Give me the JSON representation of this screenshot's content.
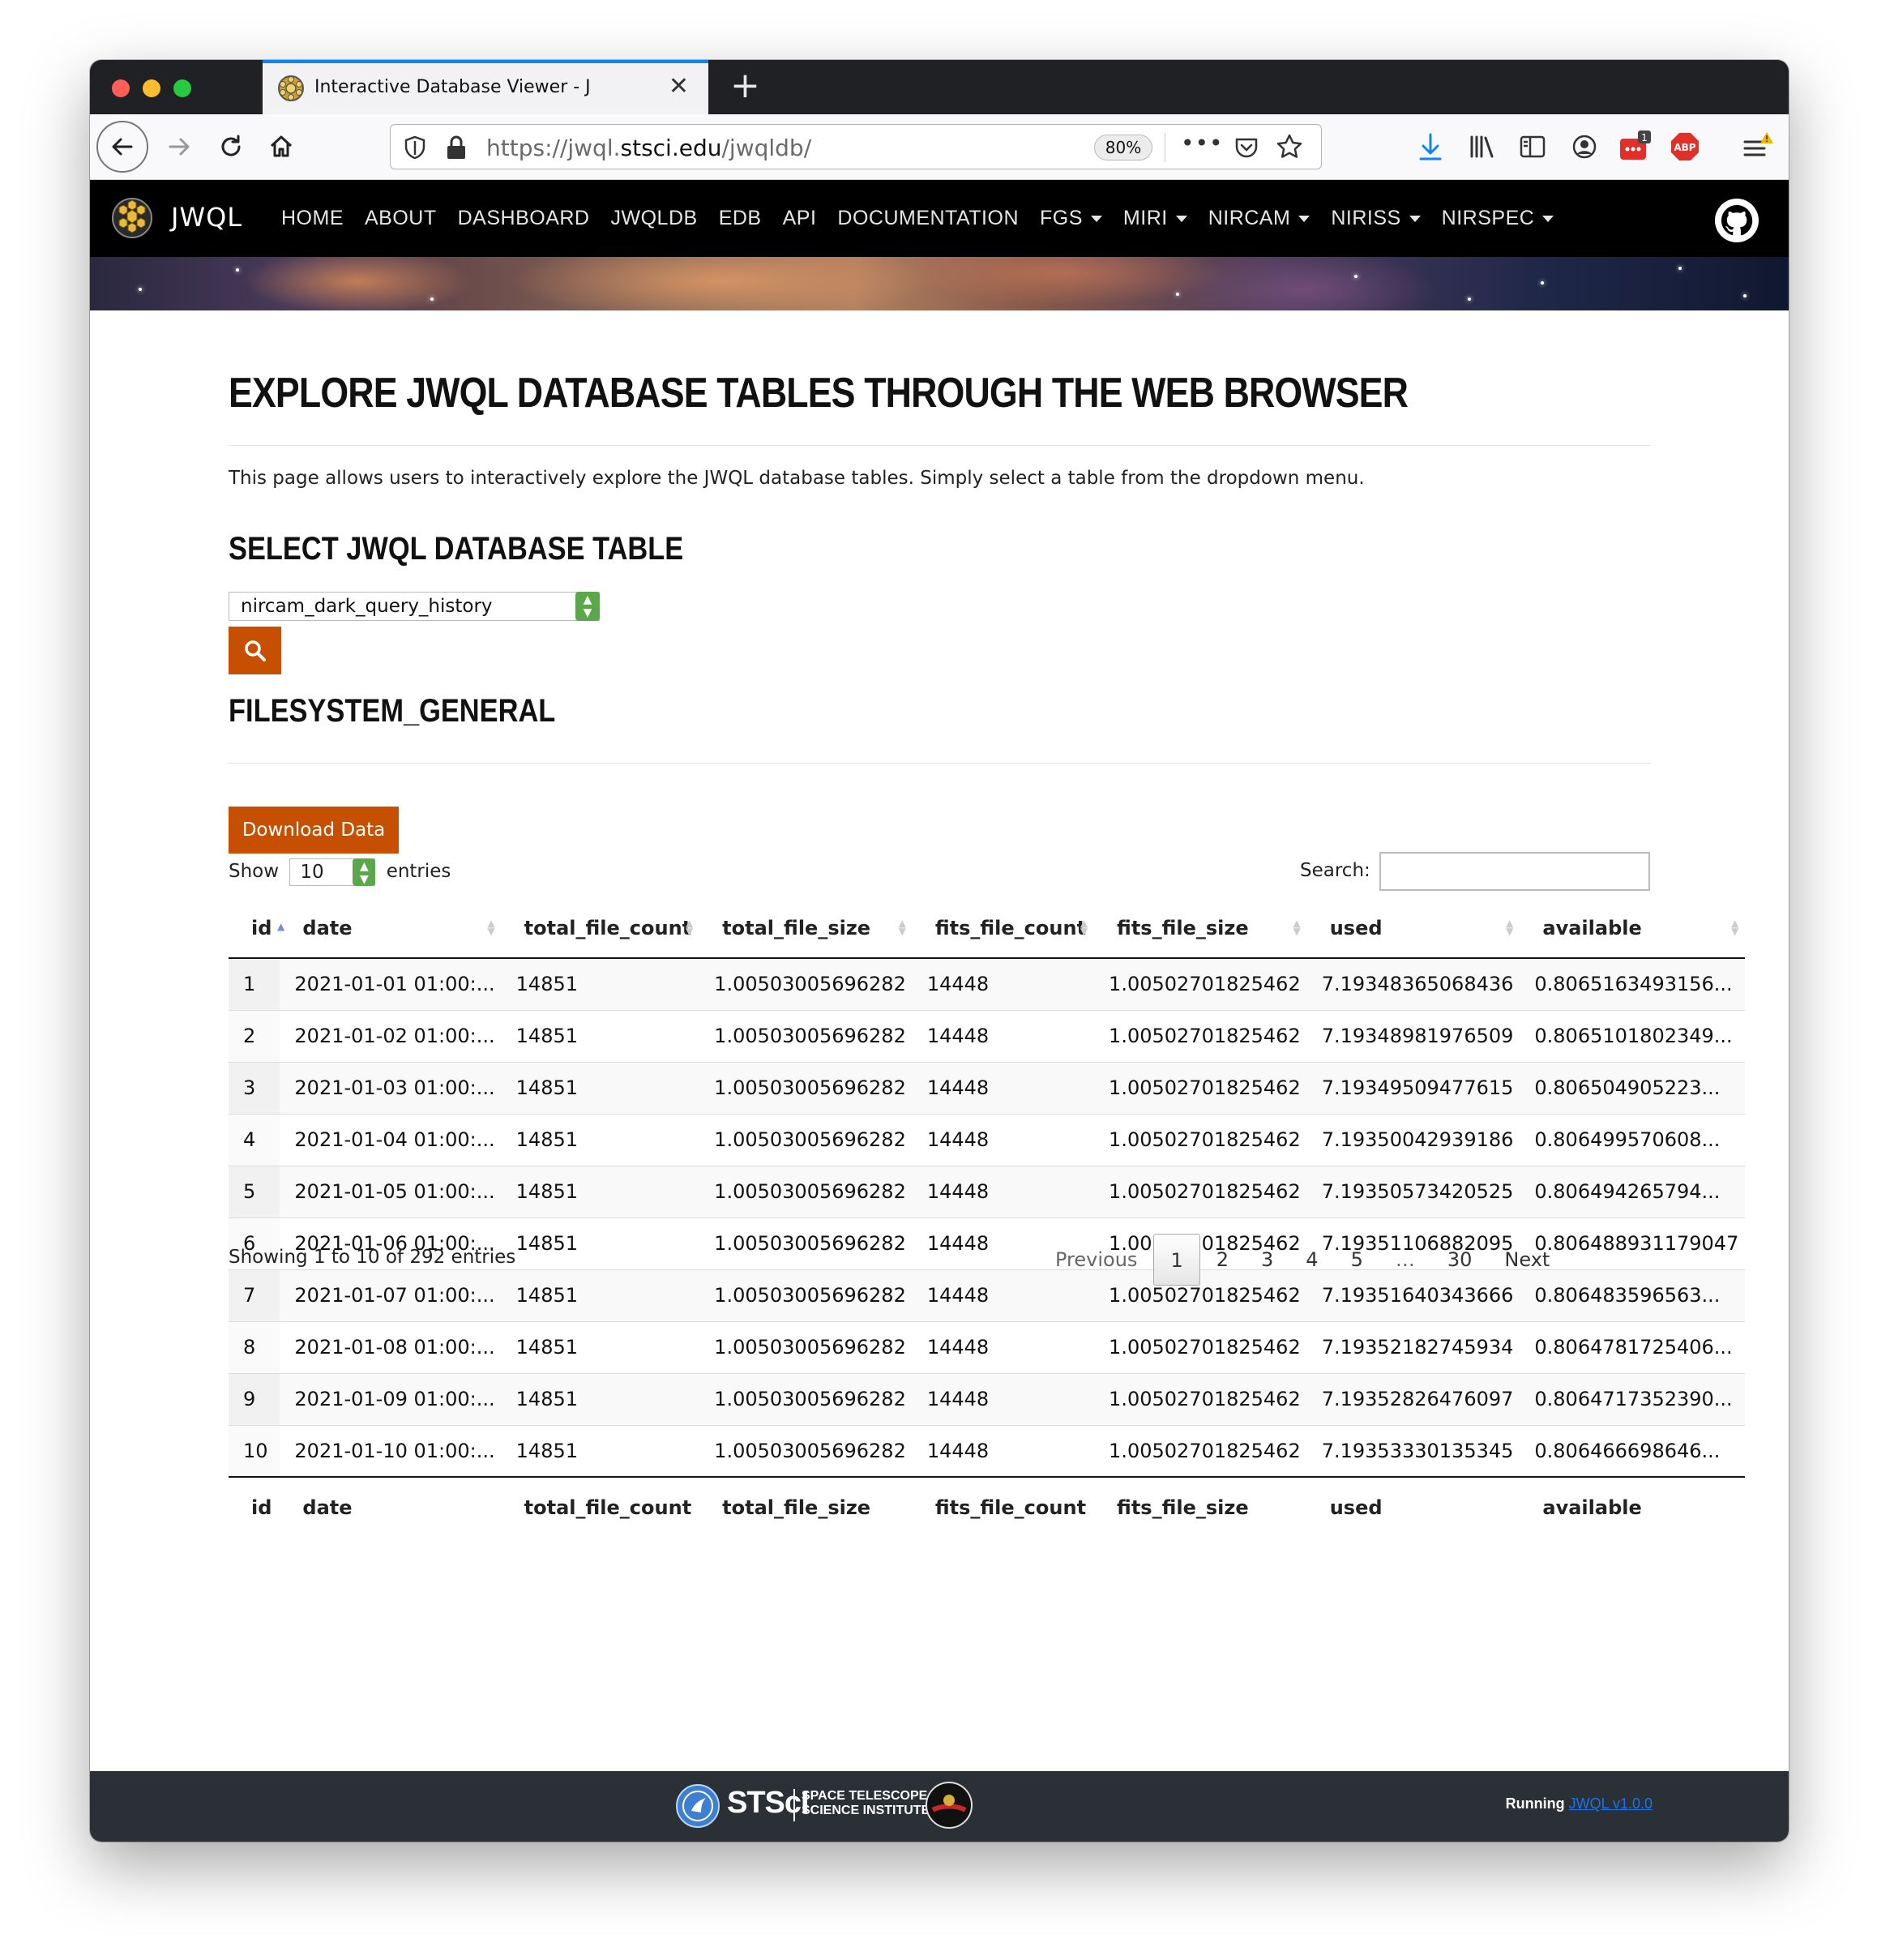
{
  "browser": {
    "tab_title": "Interactive Database Viewer - J",
    "new_tab_label": "+",
    "url_prefix": "https://jwql.",
    "url_domain": "stsci.edu",
    "url_path": "/jwqldb/",
    "zoom": "80%",
    "more_label": "•••",
    "extension_badge": "1",
    "abp_label": "ABP"
  },
  "site": {
    "brand": "JWQL",
    "nav": [
      "HOME",
      "ABOUT",
      "DASHBOARD",
      "JWQLDB",
      "EDB",
      "API",
      "DOCUMENTATION"
    ],
    "nav_dropdowns": [
      "FGS",
      "MIRI",
      "NIRCAM",
      "NIRISS",
      "NIRSPEC"
    ]
  },
  "page": {
    "heading": "EXPLORE JWQL DATABASE TABLES THROUGH THE WEB BROWSER",
    "intro": "This page allows users to interactively explore the JWQL database tables. Simply select a table from the dropdown menu.",
    "select_heading": "SELECT JWQL DATABASE TABLE",
    "selected_table": "nircam_dark_query_history",
    "table_heading": "FILESYSTEM_GENERAL",
    "download_label": "Download Data",
    "show_label": "Show",
    "show_value": "10",
    "entries_label": "entries",
    "search_label": "Search:",
    "info": "Showing 1 to 10 of 292 entries"
  },
  "table": {
    "columns": [
      "id",
      "date",
      "total_file_count",
      "total_file_size",
      "fits_file_count",
      "fits_file_size",
      "used",
      "available"
    ],
    "rows": [
      [
        "1",
        "2021-01-01 01:00:...",
        "14851",
        "1.00503005696282",
        "14448",
        "1.00502701825462",
        "7.19348365068436",
        "0.8065163493156..."
      ],
      [
        "2",
        "2021-01-02 01:00:...",
        "14851",
        "1.00503005696282",
        "14448",
        "1.00502701825462",
        "7.19348981976509",
        "0.8065101802349..."
      ],
      [
        "3",
        "2021-01-03 01:00:...",
        "14851",
        "1.00503005696282",
        "14448",
        "1.00502701825462",
        "7.19349509477615",
        "0.806504905223..."
      ],
      [
        "4",
        "2021-01-04 01:00:...",
        "14851",
        "1.00503005696282",
        "14448",
        "1.00502701825462",
        "7.19350042939186",
        "0.806499570608..."
      ],
      [
        "5",
        "2021-01-05 01:00:...",
        "14851",
        "1.00503005696282",
        "14448",
        "1.00502701825462",
        "7.19350573420525",
        "0.806494265794..."
      ],
      [
        "6",
        "2021-01-06 01:00:...",
        "14851",
        "1.00503005696282",
        "14448",
        "1.00502701825462",
        "7.19351106882095",
        "0.806488931179047"
      ],
      [
        "7",
        "2021-01-07 01:00:...",
        "14851",
        "1.00503005696282",
        "14448",
        "1.00502701825462",
        "7.19351640343666",
        "0.806483596563..."
      ],
      [
        "8",
        "2021-01-08 01:00:...",
        "14851",
        "1.00503005696282",
        "14448",
        "1.00502701825462",
        "7.19352182745934",
        "0.8064781725406..."
      ],
      [
        "9",
        "2021-01-09 01:00:...",
        "14851",
        "1.00503005696282",
        "14448",
        "1.00502701825462",
        "7.19352826476097",
        "0.8064717352390..."
      ],
      [
        "10",
        "2021-01-10 01:00:...",
        "14851",
        "1.00503005696282",
        "14448",
        "1.00502701825462",
        "7.19353330135345",
        "0.806466698646..."
      ]
    ]
  },
  "pagination": {
    "previous": "Previous",
    "pages": [
      "1",
      "2",
      "3",
      "4",
      "5",
      "…",
      "30"
    ],
    "current": "1",
    "next": "Next"
  },
  "footer": {
    "stsci": "STScI",
    "stsci_sub_1": "SPACE TELESCOPE",
    "stsci_sub_2": "SCIENCE INSTITUTE",
    "running_label": "Running",
    "version_link": "JWQL v1.0.0"
  },
  "colors": {
    "accent_orange": "#c75000",
    "nav_bg": "#000000",
    "footer_bg": "#2b2f36",
    "link_blue": "#1a73e8"
  },
  "icons": [
    "back-icon",
    "forward-icon",
    "reload-icon",
    "home-icon",
    "shield-icon",
    "lock-icon",
    "pocket-icon",
    "star-icon",
    "download-icon",
    "library-icon",
    "sidebar-icon",
    "account-icon",
    "extension-icon",
    "abp-icon",
    "menu-icon",
    "github-icon",
    "search-icon"
  ]
}
